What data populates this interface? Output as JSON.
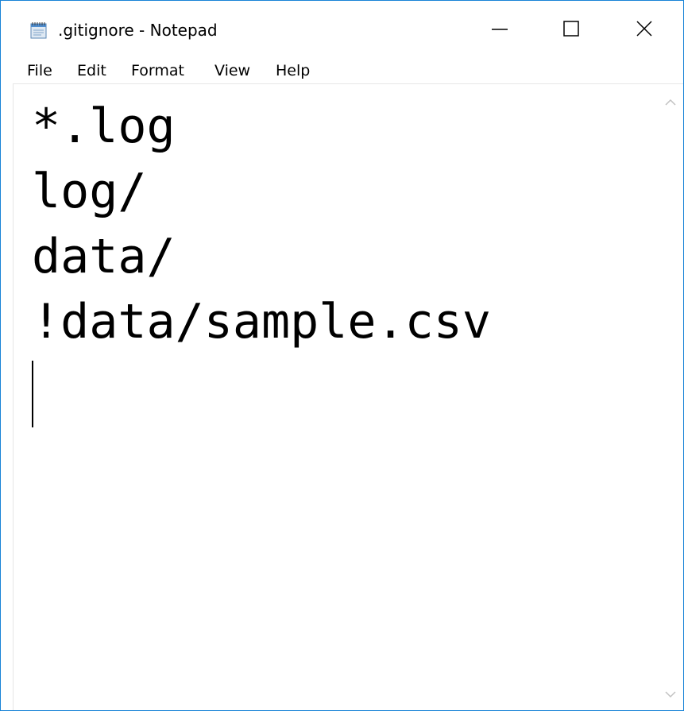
{
  "window": {
    "title": ".gitignore - Notepad",
    "icon": "notepad-icon"
  },
  "caption_buttons": {
    "minimize": "minimize-icon",
    "maximize": "maximize-icon",
    "close": "close-icon"
  },
  "menu": {
    "items": [
      "File",
      "Edit",
      "Format",
      "View",
      "Help"
    ]
  },
  "editor": {
    "lines": [
      "*.log",
      "log/",
      "data/",
      "!data/sample.csv"
    ],
    "content": "*.log\nlog/\ndata/\n!data/sample.csv"
  },
  "scrollbar": {
    "up": "chevron-up-icon",
    "down": "chevron-down-icon"
  },
  "colors": {
    "window_border": "#1883d7",
    "text": "#000000",
    "background": "#ffffff",
    "scroll_arrow": "#c2c2c2"
  }
}
